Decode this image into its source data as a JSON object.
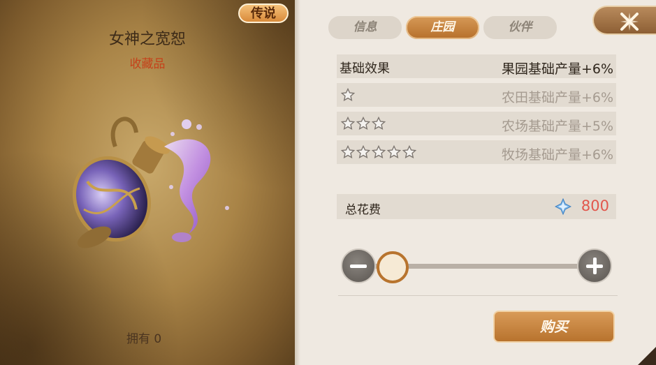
{
  "item": {
    "rarity": "传说",
    "name": "女神之宽恕",
    "type": "收藏品",
    "owned": "拥有 0",
    "image_icon": "goddess-vase-icon"
  },
  "tabs": [
    {
      "label": "信息",
      "active": false
    },
    {
      "label": "庄园",
      "active": true
    },
    {
      "label": "伙伴",
      "active": false
    }
  ],
  "effects": {
    "header_label": "基础效果",
    "header_value": "果园基础产量+6%",
    "rows": [
      {
        "stars": 1,
        "value": "农田基础产量+6%"
      },
      {
        "stars": 3,
        "value": "农场基础产量+5%"
      },
      {
        "stars": 5,
        "value": "牧场基础产量+6%"
      }
    ]
  },
  "cost": {
    "label": "总花费",
    "value": "800",
    "icon": "crystal-icon"
  },
  "quantity_slider": {
    "value": 0
  },
  "buy_label": "购买",
  "colors": {
    "accent": "#c07a34",
    "cost_value": "#e2574c",
    "rarity_text": "#c5421a"
  }
}
